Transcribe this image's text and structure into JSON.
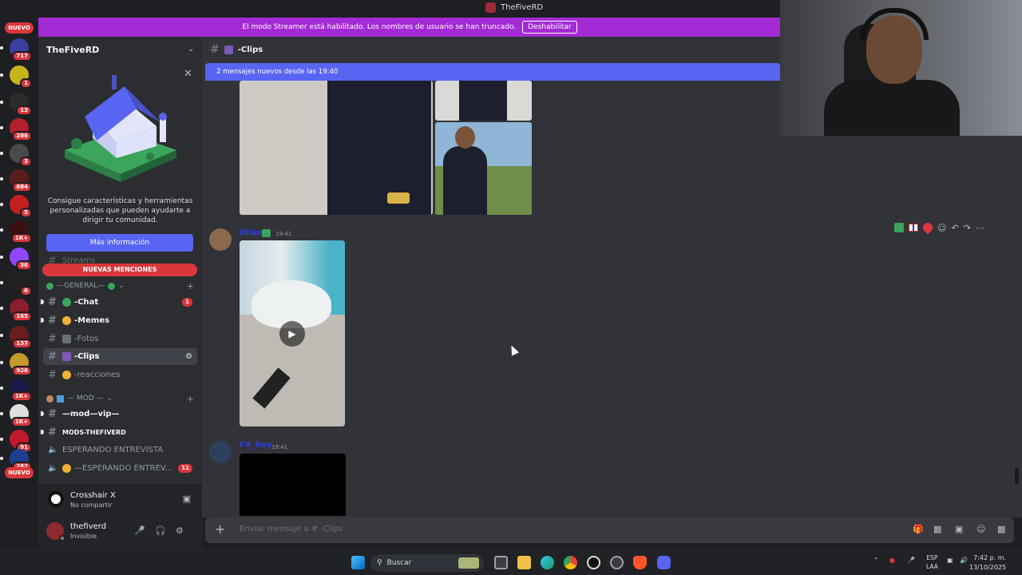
{
  "window": {
    "title": "TheFiveRD"
  },
  "banner": {
    "text": "El modo Streamer está habilitado. Los nombres de usuario se han truncado.",
    "button": "Deshabilitar"
  },
  "rail": {
    "new_top": "NUEVO",
    "new_bottom": "NUEVO",
    "servers": [
      {
        "badge": "717",
        "color": "#3b3f9f"
      },
      {
        "badge": "1",
        "color": "#c8b21e"
      },
      {
        "badge": "13",
        "color": "#2b2b2b"
      },
      {
        "badge": "286",
        "color": "#b3202b"
      },
      {
        "badge": "3",
        "color": "#4a4a4a"
      },
      {
        "badge": "684",
        "color": "#5b1c1c"
      },
      {
        "badge": "5",
        "color": "#c41e1e"
      },
      {
        "badge": "1K+",
        "color": "#3a1010"
      },
      {
        "badge": "36",
        "color": "#9146ff"
      },
      {
        "badge": "6",
        "color": "#222222"
      },
      {
        "badge": "165",
        "color": "#8a1e2d"
      },
      {
        "badge": "137",
        "color": "#6b1c1c"
      },
      {
        "badge": "926",
        "color": "#c59a2a"
      },
      {
        "badge": "1K+",
        "color": "#1a1a4a"
      },
      {
        "badge": "1K+",
        "color": "#e0e0e0"
      },
      {
        "badge": "91",
        "color": "#c0182c"
      },
      {
        "badge": "282",
        "color": "#1c3f8f"
      }
    ]
  },
  "sidebar": {
    "guild_name": "TheFiveRD",
    "promo_text": "Consigue características y herramientas personalizadas que pueden ayudarte a dirigir tu comunidad.",
    "promo_button": "Más información",
    "hidden_channel": "Streams",
    "mentions_pill": "NUEVAS MENCIONES",
    "category_general": "—GENERAL—",
    "channels": [
      {
        "label": "-Chat",
        "badge": "1"
      },
      {
        "label": "-Memes"
      },
      {
        "label": "-Fotos"
      },
      {
        "label": "-Clips"
      },
      {
        "label": "-reacciones"
      }
    ],
    "category_mod": "— MOD —",
    "mod_channels": [
      {
        "label": "—mod—vip—"
      },
      {
        "label": "MODS-THEFIVERD"
      }
    ],
    "voice_channels": [
      {
        "label": "ESPERANDO ENTREVISTA"
      },
      {
        "label": "—ESPERANDO ENTREV...",
        "badge": "11"
      }
    ]
  },
  "activity": {
    "name": "Crosshair X",
    "sub": "No compartir"
  },
  "user": {
    "name": "thefiverd",
    "status": "Invisible"
  },
  "chat": {
    "channel": "-Clips",
    "new_messages": "2 mensajes nuevos desde las 19:40",
    "messages": [
      {
        "author": "Dilan",
        "time": "19:41"
      },
      {
        "author": "FX_Rey",
        "time": "19:41"
      }
    ],
    "composer_placeholder": "Enviar mensaje a # -Clips"
  },
  "taskbar": {
    "search": "Buscar",
    "lang_top": "ESP",
    "lang_bottom": "LAA",
    "time": "7:42 p. m.",
    "date": "13/10/2025"
  }
}
